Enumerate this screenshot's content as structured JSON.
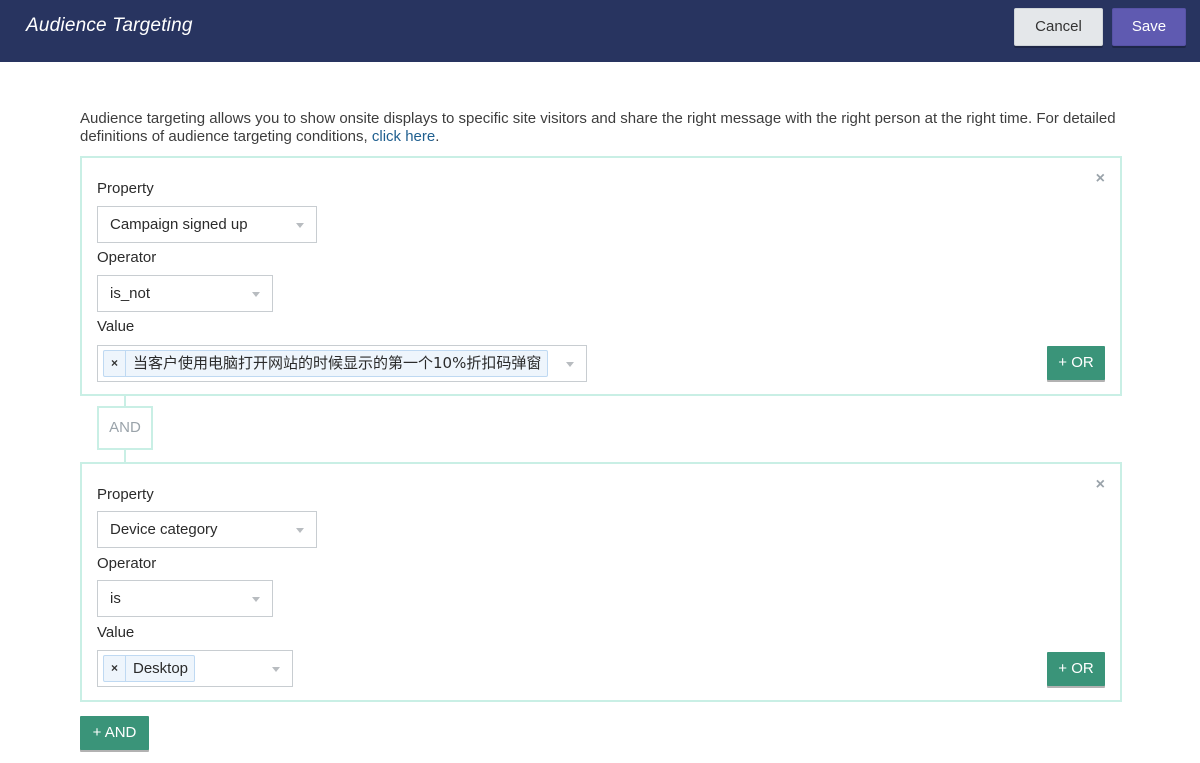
{
  "header": {
    "title": "Audience Targeting",
    "cancel_label": "Cancel",
    "save_label": "Save"
  },
  "intro": {
    "text": "Audience targeting allows you to show onsite displays to specific site visitors and share the right message with the right person at the right time. For detailed definitions of audience targeting conditions, ",
    "link_text": "click here",
    "suffix": "."
  },
  "rules": [
    {
      "close_icon": "×",
      "property_label": "Property",
      "property_value": "Campaign signed up",
      "operator_label": "Operator",
      "operator_value": "is_not",
      "value_label": "Value",
      "value_chips": [
        "当客户使用电脑打开网站的时候显示的第一个10%折扣码弹窗"
      ],
      "or_label": "+ OR"
    },
    {
      "close_icon": "×",
      "property_label": "Property",
      "property_value": "Device category",
      "operator_label": "Operator",
      "operator_value": "is",
      "value_label": "Value",
      "value_chips": [
        "Desktop"
      ],
      "or_label": "+ OR"
    }
  ],
  "connector": {
    "and_label": "AND"
  },
  "footer": {
    "add_and_label": "+ AND"
  },
  "colors": {
    "header_bg": "#283460",
    "save_bg": "#5f5ab1",
    "accent_green": "#3a9479",
    "rule_border": "#c9efe5"
  }
}
